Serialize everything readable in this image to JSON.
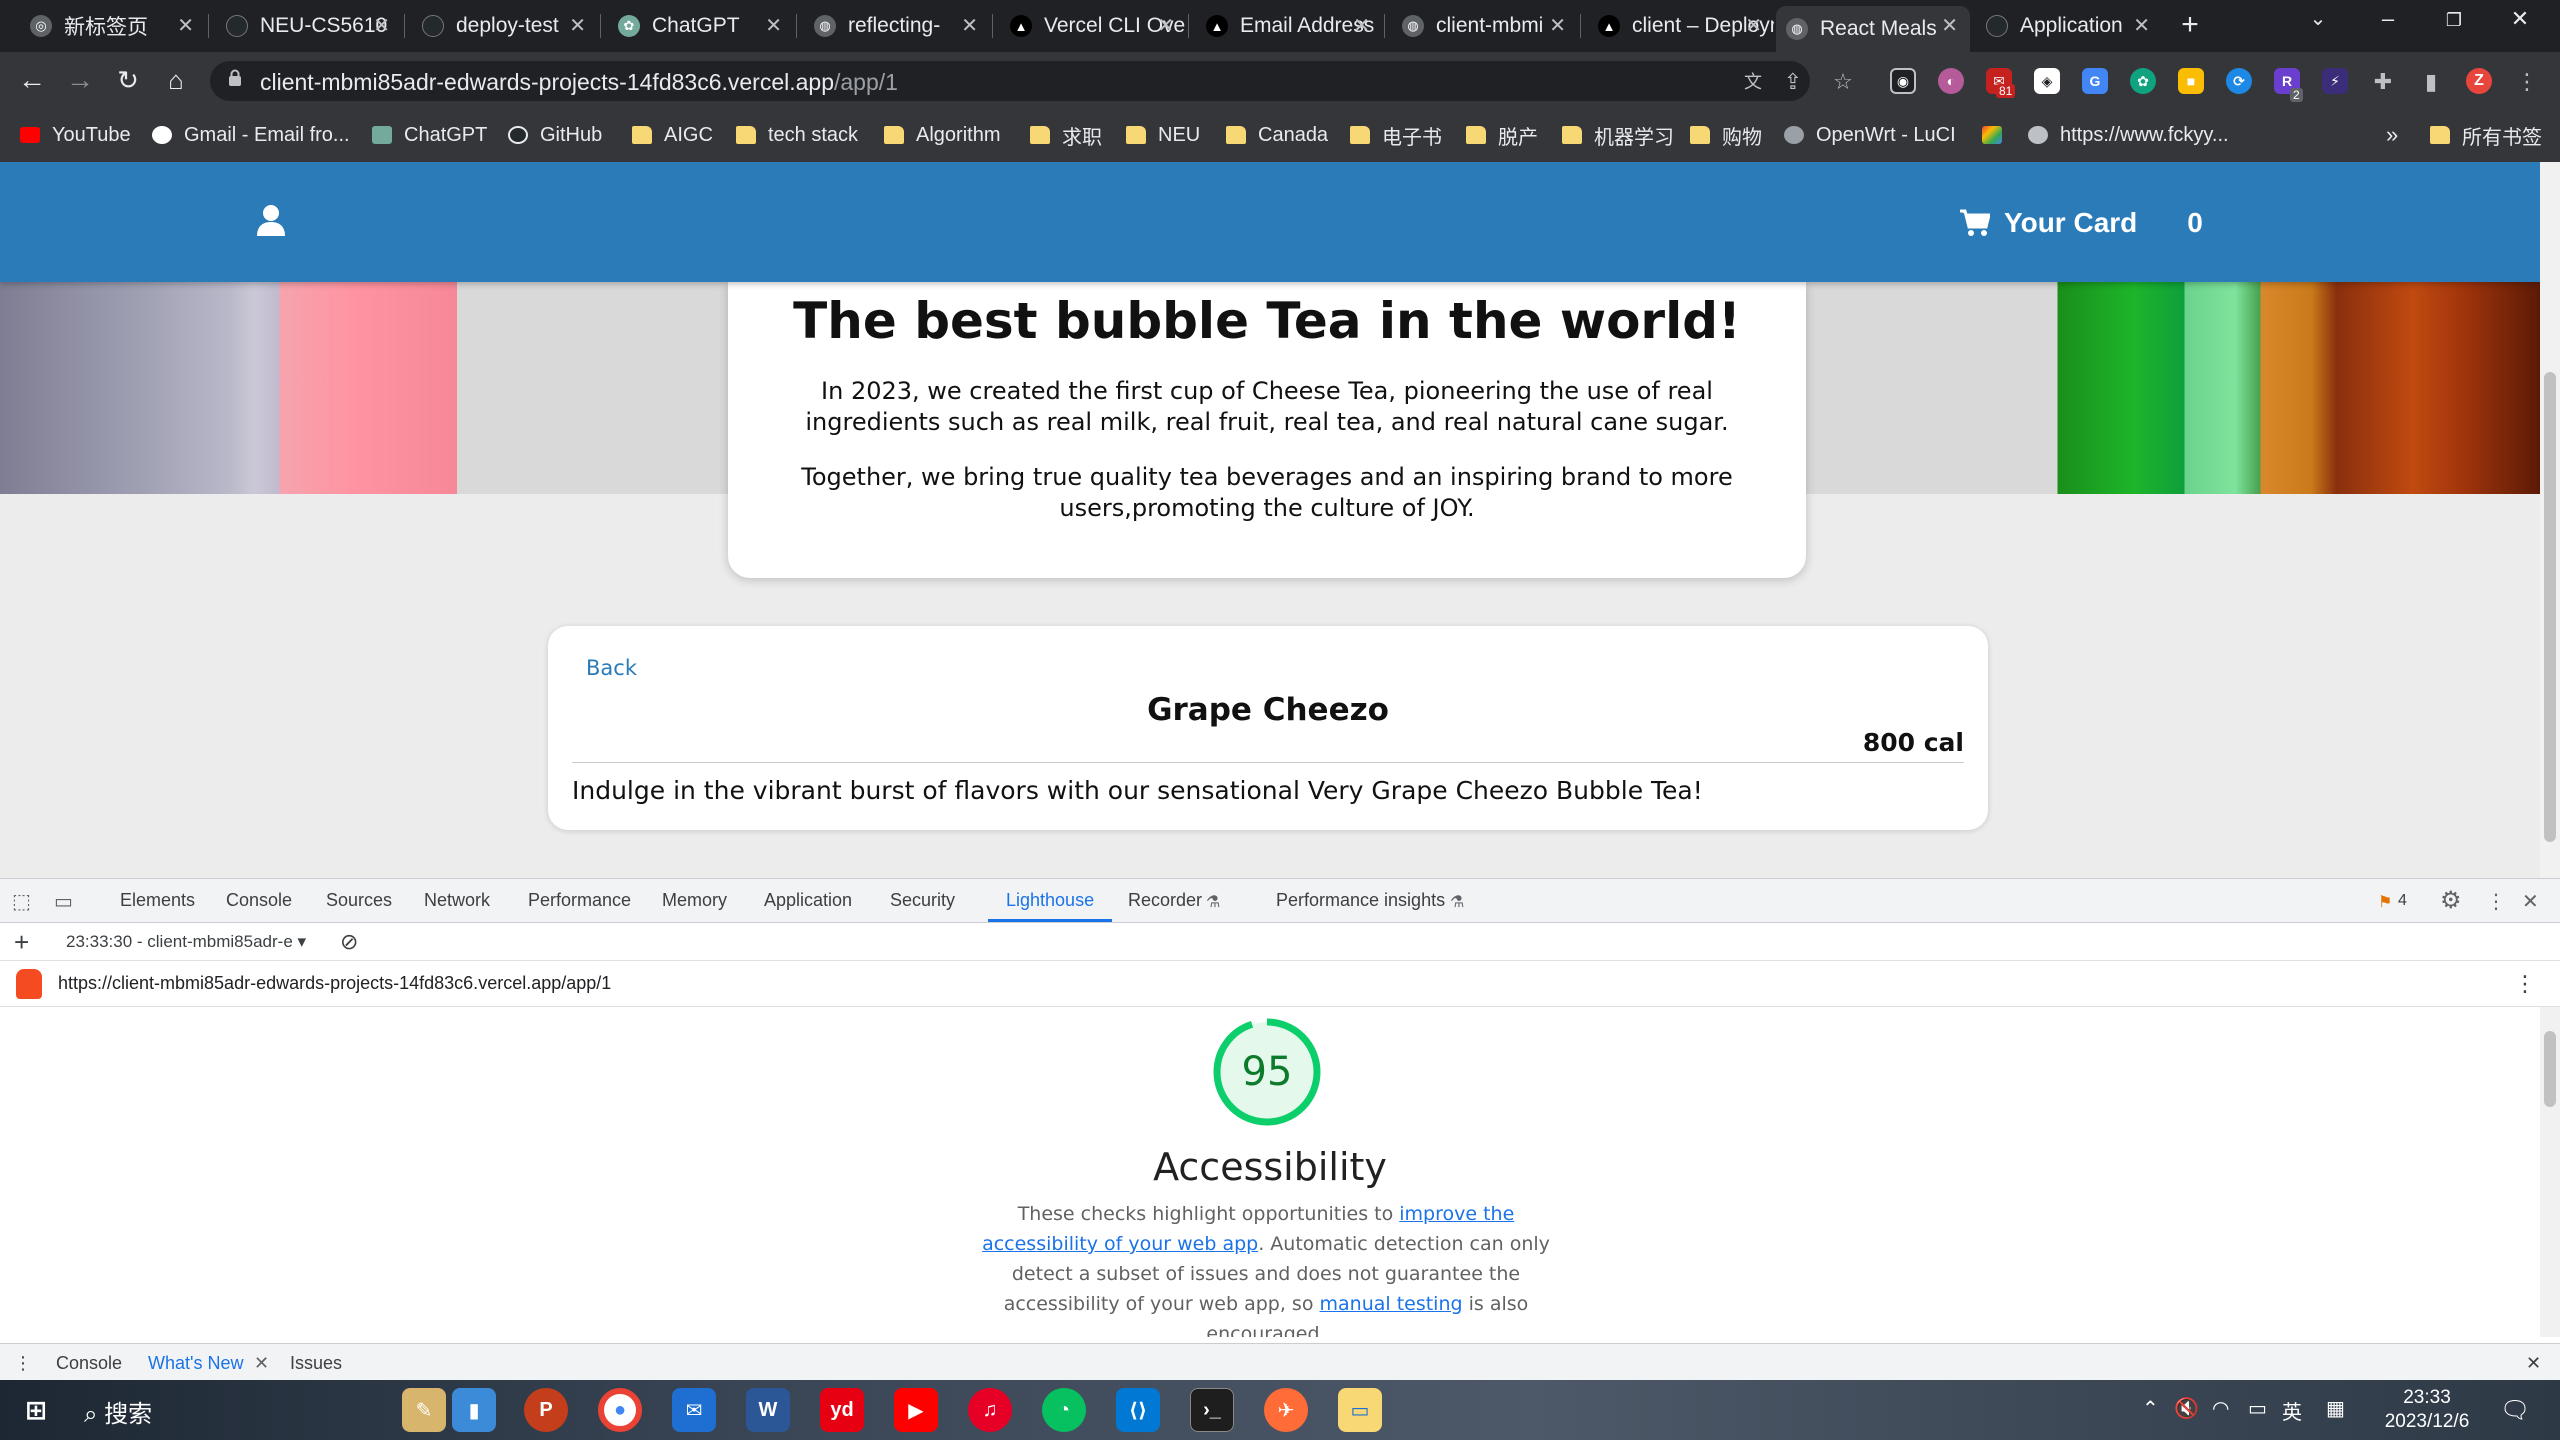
{
  "browser": {
    "tabs": [
      {
        "title": "新标签页",
        "fav_color": "#5f6368"
      },
      {
        "title": "NEU-CS5610",
        "fav_color": "#24292e"
      },
      {
        "title": "deploy-test",
        "fav_color": "#24292e"
      },
      {
        "title": "ChatGPT",
        "fav_color": "#74aa9c"
      },
      {
        "title": "reflecting-",
        "fav_color": "#5f6368"
      },
      {
        "title": "Vercel CLI Overview",
        "fav_color": "#000000"
      },
      {
        "title": "Email Address",
        "fav_color": "#000000"
      },
      {
        "title": "client-mbmi",
        "fav_color": "#5f6368"
      },
      {
        "title": "client – Deployment",
        "fav_color": "#000000"
      },
      {
        "title": "React Meals",
        "fav_color": "#5f6368"
      },
      {
        "title": "Application",
        "fav_color": "#24292e"
      }
    ],
    "url_host": "client-mbmi85adr-edwards-projects-14fd83c6.vercel.app",
    "url_path": "/app/1",
    "profile_initial": "Z",
    "ext_badges": {
      "gmail": "81",
      "r": "2"
    },
    "bookmarks": [
      {
        "label": "YouTube",
        "type": "youtube"
      },
      {
        "label": "Gmail - Email fro...",
        "type": "google"
      },
      {
        "label": "ChatGPT",
        "type": "chatgpt"
      },
      {
        "label": "GitHub",
        "type": "github"
      },
      {
        "label": "AIGC",
        "type": "folder"
      },
      {
        "label": "tech stack",
        "type": "folder"
      },
      {
        "label": "Algorithm",
        "type": "folder"
      },
      {
        "label": "求职",
        "type": "folder"
      },
      {
        "label": "NEU",
        "type": "folder"
      },
      {
        "label": "Canada",
        "type": "folder"
      },
      {
        "label": "电子书",
        "type": "folder"
      },
      {
        "label": "脱产",
        "type": "folder"
      },
      {
        "label": "机器学习",
        "type": "folder"
      },
      {
        "label": "购物",
        "type": "folder"
      },
      {
        "label": "OpenWrt - LuCI",
        "type": "openwrt"
      },
      {
        "label": "",
        "type": "gmail"
      },
      {
        "label": "https://www.fckyy...",
        "type": "web"
      }
    ],
    "all_bookmarks": "所有书签",
    "bookmarks_overflow": "»"
  },
  "site": {
    "cart_label": "Your Card",
    "cart_count": "0",
    "hero_title": "The best bubble Tea in the world!",
    "hero_p1": "In 2023, we created the first cup of Cheese Tea, pioneering the use of real ingredients such as real milk, real fruit, real tea, and real natural cane sugar.",
    "hero_p2": "Together, we bring true quality tea beverages and an inspiring brand to more users,promoting the culture of JOY.",
    "meal": {
      "back": "Back",
      "name": "Grape Cheezo",
      "calories": "800 cal",
      "description": "Indulge in the vibrant burst of flavors with our sensational Very Grape Cheezo Bubble Tea!"
    }
  },
  "devtools": {
    "tabs": [
      "Elements",
      "Console",
      "Sources",
      "Network",
      "Performance",
      "Memory",
      "Application",
      "Security",
      "Lighthouse",
      "Recorder",
      "Performance insights"
    ],
    "active_tab": "Lighthouse",
    "issues_count": "4",
    "report_select": "23:33:30 - client-mbmi85adr-e",
    "report_url": "https://client-mbmi85adr-edwards-projects-14fd83c6.vercel.app/app/1",
    "score": 95,
    "score_color": "#0cce6b",
    "category_title": "Accessibility",
    "desc_1": "These checks highlight opportunities to ",
    "desc_link_1": "improve the accessibility of your web app",
    "desc_2": ". Automatic detection can only detect a subset of issues and does not guarantee the accessibility of your web app, so ",
    "desc_link_2": "manual testing",
    "desc_3": " is also encouraged.",
    "drawer_tabs": [
      "Console",
      "What's New",
      "Issues"
    ],
    "drawer_active": "What's New"
  },
  "taskbar": {
    "search_label": "搜索",
    "ime": "英",
    "time": "23:33",
    "date": "2023/12/6"
  }
}
